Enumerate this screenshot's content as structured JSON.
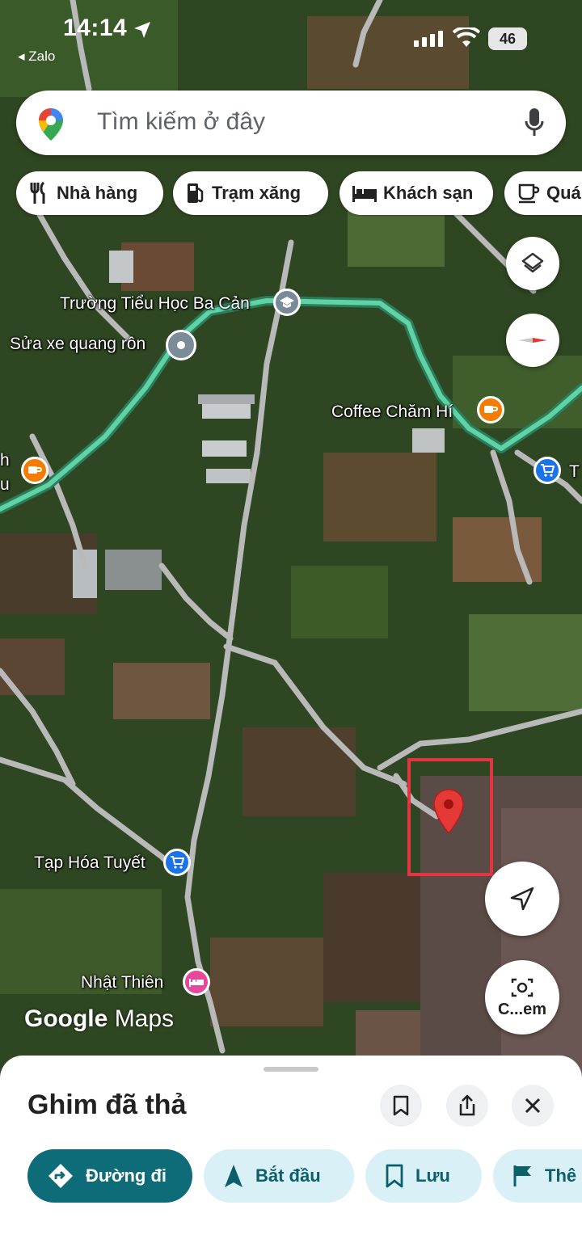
{
  "status_bar": {
    "time": "14:14",
    "back_app": "◂ Zalo",
    "battery": "46"
  },
  "search": {
    "placeholder": "Tìm kiếm ở đây"
  },
  "chips": [
    {
      "label": "Nhà hàng",
      "icon": "restaurant-icon"
    },
    {
      "label": "Trạm xăng",
      "icon": "gas-station-icon"
    },
    {
      "label": "Khách sạn",
      "icon": "hotel-icon"
    },
    {
      "label": "Quá",
      "icon": "cafe-icon"
    }
  ],
  "map": {
    "labels": {
      "school": "Trường Tiểu Học Ba Cản",
      "repair": "Sửa xe quang rôn",
      "coffee": "Coffee Chăm Hí",
      "edge_left_1": "h",
      "edge_left_2": "u",
      "edge_right": "T",
      "grocery": "Tạp Hóa Tuyết",
      "hotel": "Nhật Thiên"
    },
    "watermark_brand": "Google",
    "watermark_product": "Maps",
    "camera_button": "C...em",
    "colors": {
      "route": "#4fc59a",
      "pin": "#e53935",
      "highlight_box": "#e53342",
      "cafe_poi": "#f57c00",
      "shop_poi": "#1a73e8",
      "hotel_poi": "#e8489c"
    }
  },
  "sheet": {
    "title": "Ghim đã thả",
    "actions": [
      {
        "label": "Đường đi",
        "icon": "directions-icon"
      },
      {
        "label": "Bắt đầu",
        "icon": "navigation-arrow-icon"
      },
      {
        "label": "Lưu",
        "icon": "bookmark-icon"
      },
      {
        "label": "Thê",
        "icon": "flag-icon"
      }
    ]
  }
}
